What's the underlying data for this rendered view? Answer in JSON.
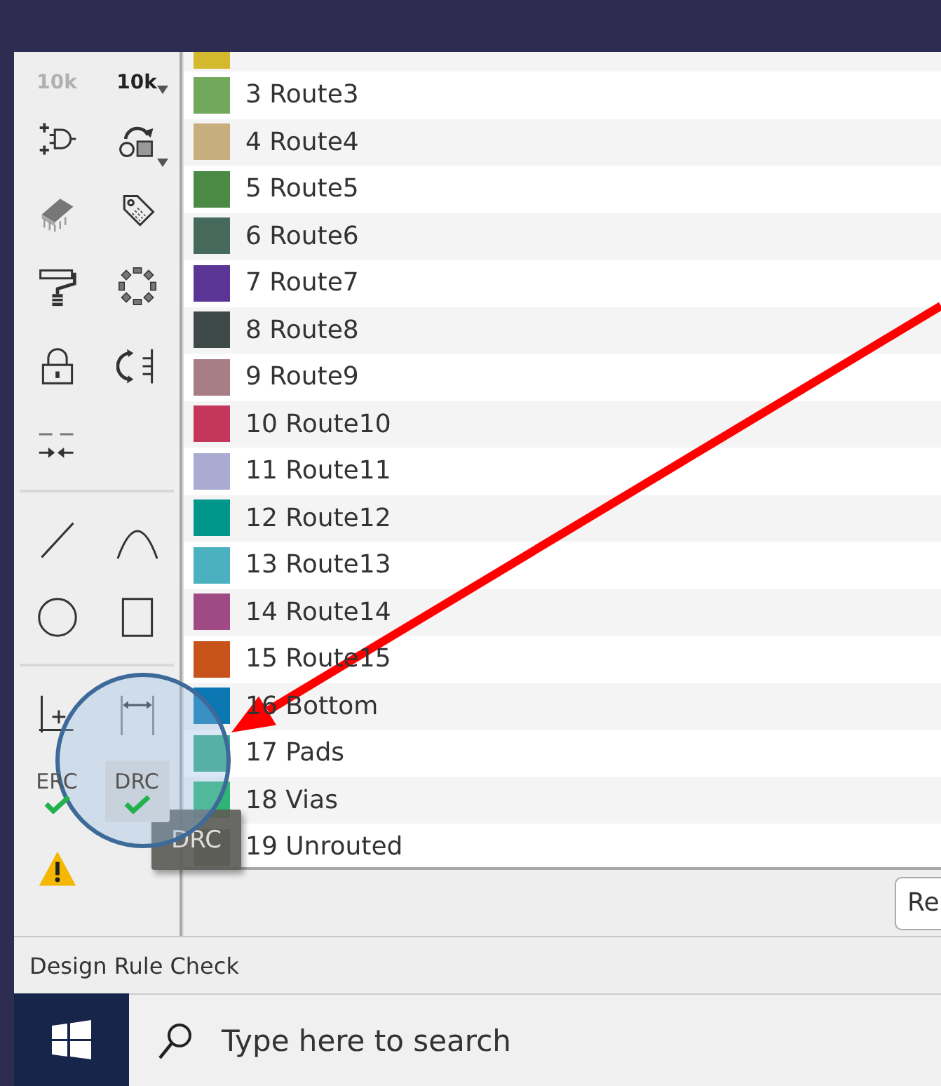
{
  "toolbar": {
    "groups": [
      {
        "tools": [
          {
            "kind": "resistor",
            "label": "10k",
            "disabled": true,
            "dropdown": false
          },
          {
            "kind": "resistor",
            "label": "10k",
            "disabled": false,
            "dropdown": true
          },
          {
            "kind": "gate",
            "dropdown": false
          },
          {
            "kind": "swap-shape",
            "dropdown": true
          },
          {
            "kind": "chip",
            "dropdown": false
          },
          {
            "kind": "tag",
            "dropdown": false
          },
          {
            "kind": "roller",
            "dropdown": false
          },
          {
            "kind": "pad-ring",
            "dropdown": false
          },
          {
            "kind": "lock",
            "dropdown": false
          },
          {
            "kind": "flip",
            "dropdown": false
          },
          {
            "kind": "align",
            "dropdown": false
          }
        ]
      },
      {
        "tools": [
          {
            "kind": "line",
            "dropdown": false
          },
          {
            "kind": "arc",
            "dropdown": false
          },
          {
            "kind": "circle",
            "dropdown": false
          },
          {
            "kind": "rect",
            "dropdown": false
          }
        ]
      },
      {
        "tools": [
          {
            "kind": "origin",
            "dropdown": false
          },
          {
            "kind": "dimension",
            "dropdown": false
          },
          {
            "kind": "check",
            "label": "ERC",
            "highlighted": false,
            "dropdown": false
          },
          {
            "kind": "check",
            "label": "DRC",
            "highlighted": true,
            "dropdown": false
          },
          {
            "kind": "warning",
            "dropdown": false
          }
        ]
      }
    ]
  },
  "layer_list": {
    "cut_row": {
      "color": "#d4b82e"
    },
    "rows": [
      {
        "label": "3 Route3",
        "color": "#72a85c"
      },
      {
        "label": "4 Route4",
        "color": "#c8ad7f"
      },
      {
        "label": "5 Route5",
        "color": "#4a8a44"
      },
      {
        "label": "6 Route6",
        "color": "#456a5c"
      },
      {
        "label": "7 Route7",
        "color": "#5b3596"
      },
      {
        "label": "8 Route8",
        "color": "#3e4a48"
      },
      {
        "label": "9 Route9",
        "color": "#a87e85"
      },
      {
        "label": "10 Route10",
        "color": "#c4365a"
      },
      {
        "label": "11 Route11",
        "color": "#a9acd0"
      },
      {
        "label": "12 Route12",
        "color": "#009689"
      },
      {
        "label": "13 Route13",
        "color": "#4bb1c0"
      },
      {
        "label": "14 Route14",
        "color": "#9f4a85"
      },
      {
        "label": "15 Route15",
        "color": "#c8531a"
      },
      {
        "label": "16 Bottom",
        "color": "#0a77b3"
      },
      {
        "label": "17 Pads",
        "color": "#36aa85"
      },
      {
        "label": "18 Vias",
        "color": "#2eb575"
      },
      {
        "label": "19 Unrouted",
        "color": "#6b6a55"
      }
    ]
  },
  "button": "Re",
  "tooltip": "DRC",
  "status_bar": "Design Rule Check",
  "taskbar": {
    "search_placeholder": "Type here to search"
  },
  "annotations": {
    "highlight_circle": true,
    "arrow": true
  }
}
